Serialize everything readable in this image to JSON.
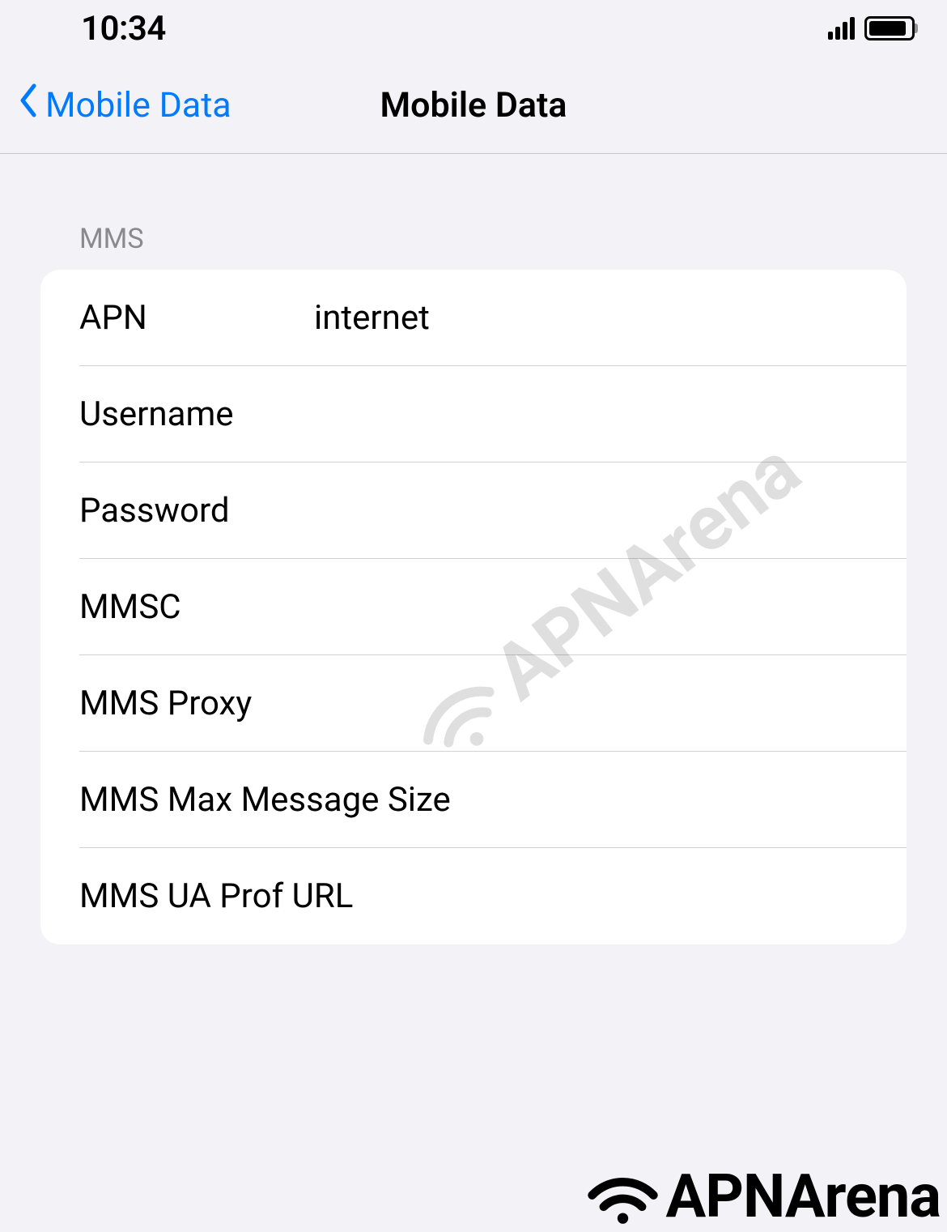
{
  "status_bar": {
    "time": "10:34"
  },
  "nav": {
    "back_label": "Mobile Data",
    "title": "Mobile Data"
  },
  "section": {
    "header": "MMS",
    "rows": [
      {
        "label": "APN",
        "value": "internet"
      },
      {
        "label": "Username",
        "value": ""
      },
      {
        "label": "Password",
        "value": ""
      },
      {
        "label": "MMSC",
        "value": ""
      },
      {
        "label": "MMS Proxy",
        "value": ""
      },
      {
        "label": "MMS Max Message Size",
        "value": ""
      },
      {
        "label": "MMS UA Prof URL",
        "value": ""
      }
    ]
  },
  "watermark": {
    "text": "APNArena"
  },
  "footer": {
    "brand": "APNArena"
  }
}
